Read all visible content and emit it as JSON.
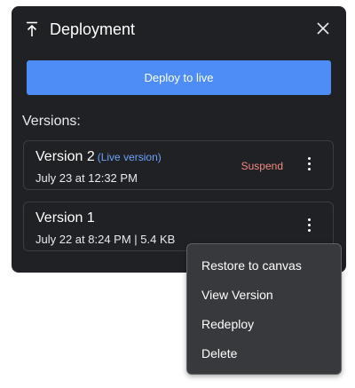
{
  "header": {
    "title": "Deployment"
  },
  "deploy_button_label": "Deploy to live",
  "versions_label": "Versions:",
  "versions": [
    {
      "name": "Version 2",
      "badge": "(Live version)",
      "date": "July 23 at 12:32 PM",
      "action": "Suspend"
    },
    {
      "name": "Version 1",
      "date": "July 22 at 8:24 PM | 5.4 KB"
    }
  ],
  "context_menu": {
    "items": [
      "Restore to canvas",
      "View Version",
      "Redeploy",
      "Delete"
    ]
  },
  "colors": {
    "panel_bg": "#202124",
    "accent": "#4e8df5",
    "live_badge": "#6ea2f7",
    "danger": "#f28b82",
    "menu_bg": "#38393c"
  },
  "icons": {
    "header_icon": "upload-icon",
    "close": "close-icon",
    "more": "more-vertical-icon"
  }
}
